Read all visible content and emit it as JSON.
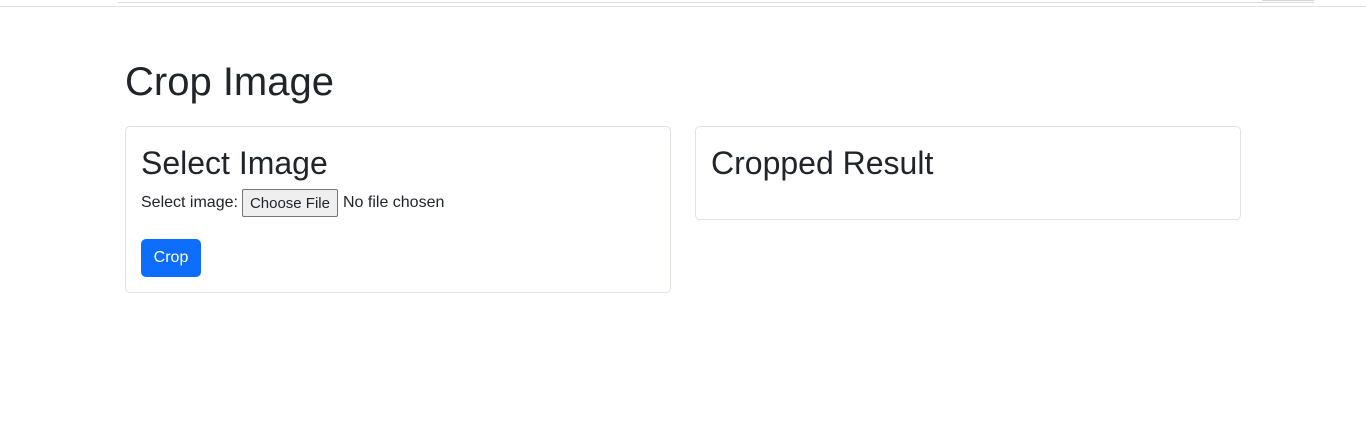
{
  "page": {
    "title": "Crop Image"
  },
  "select_card": {
    "title": "Select Image",
    "file_label": "Select image:",
    "choose_file_label": "Choose File",
    "file_status": "No file chosen",
    "crop_label": "Crop"
  },
  "result_card": {
    "title": "Cropped Result"
  },
  "colors": {
    "primary": "#0d6efd",
    "text": "#212529",
    "border": "#dee2e6"
  }
}
